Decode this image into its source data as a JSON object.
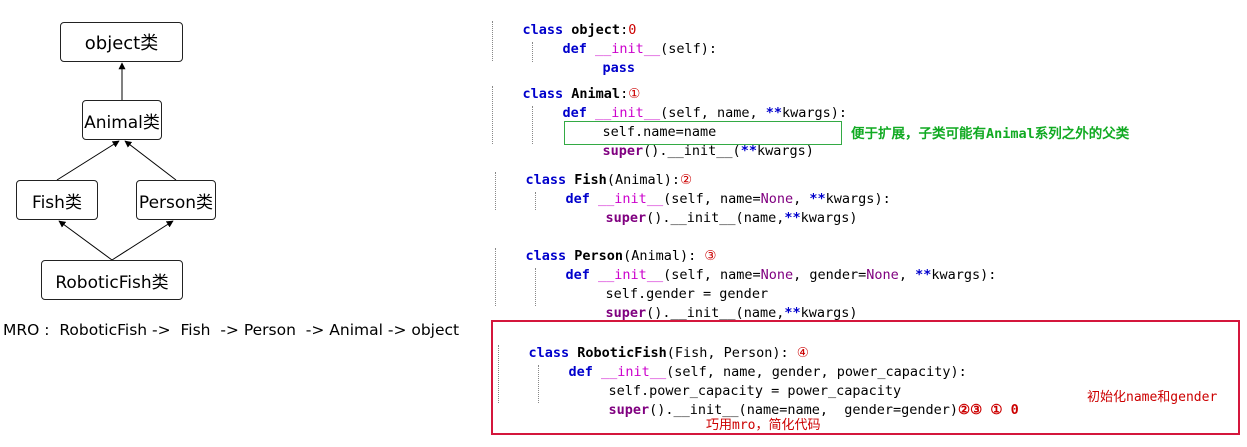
{
  "diagram": {
    "object": "object类",
    "animal": "Animal类",
    "fish": "Fish类",
    "person": "Person类",
    "robotic": "RoboticFish类",
    "mro": "MRO :  RoboticFish ->  Fish  -> Person  -> Animal -> object"
  },
  "code": {
    "object_block": {
      "class_kw": "class",
      "name": "object",
      "colon": ":",
      "mark": "0",
      "def_kw": "def",
      "init": "__init__",
      "params": "(self):",
      "pass_kw": "pass"
    },
    "animal_block": {
      "class_kw": "class",
      "name": "Animal",
      "colon": ":",
      "mark": "①",
      "def_kw": "def",
      "init": "__init__",
      "params_a": "(self, name, ",
      "stars": "**",
      "params_b": "kwargs):",
      "assign": "self.name=name",
      "super_kw": "super",
      "super_rest_a": "().__init__(",
      "super_stars": "**",
      "super_rest_b": "kwargs)",
      "note": "便于扩展，子类可能有Animal系列之外的父类"
    },
    "fish_block": {
      "class_kw": "class",
      "name": "Fish",
      "bases": "(Animal):",
      "mark": "②",
      "def_kw": "def",
      "init": "__init__",
      "params_a": "(self, name=",
      "none": "None",
      "params_b": ", ",
      "stars": "**",
      "params_c": "kwargs):",
      "super_kw": "super",
      "super_rest_a": "().__init__(name,",
      "super_stars": "**",
      "super_rest_b": "kwargs)"
    },
    "person_block": {
      "class_kw": "class",
      "name": "Person",
      "bases": "(Animal):",
      "mark": "③",
      "def_kw": "def",
      "init": "__init__",
      "params_a": "(self, name=",
      "none1": "None",
      "params_b": ", gender=",
      "none2": "None",
      "params_c": ", ",
      "stars": "**",
      "params_d": "kwargs):",
      "assign": "self.gender = gender",
      "super_kw": "super",
      "super_rest_a": "().__init__(name,",
      "super_stars": "**",
      "super_rest_b": "kwargs)"
    },
    "robotic_block": {
      "class_kw": "class",
      "name": "RoboticFish",
      "bases": "(Fish, Person):",
      "mark": "④",
      "def_kw": "def",
      "init": "__init__",
      "params": "(self, name, gender, power_capacity):",
      "assign": "self.power_capacity = power_capacity",
      "super_kw": "super",
      "super_rest": "().__init__(name=name,  gender=gender)",
      "marks": "②③ ① 0",
      "note_init": "初始化name和gender",
      "note_mro": "巧用mro，简化代码"
    }
  },
  "colors": {
    "keyword": "#0000cc",
    "dunder": "#cc00cc",
    "constant": "#800080",
    "marker": "#cc0000",
    "note_green": "#11aa22",
    "frame_red": "#d4163c"
  }
}
